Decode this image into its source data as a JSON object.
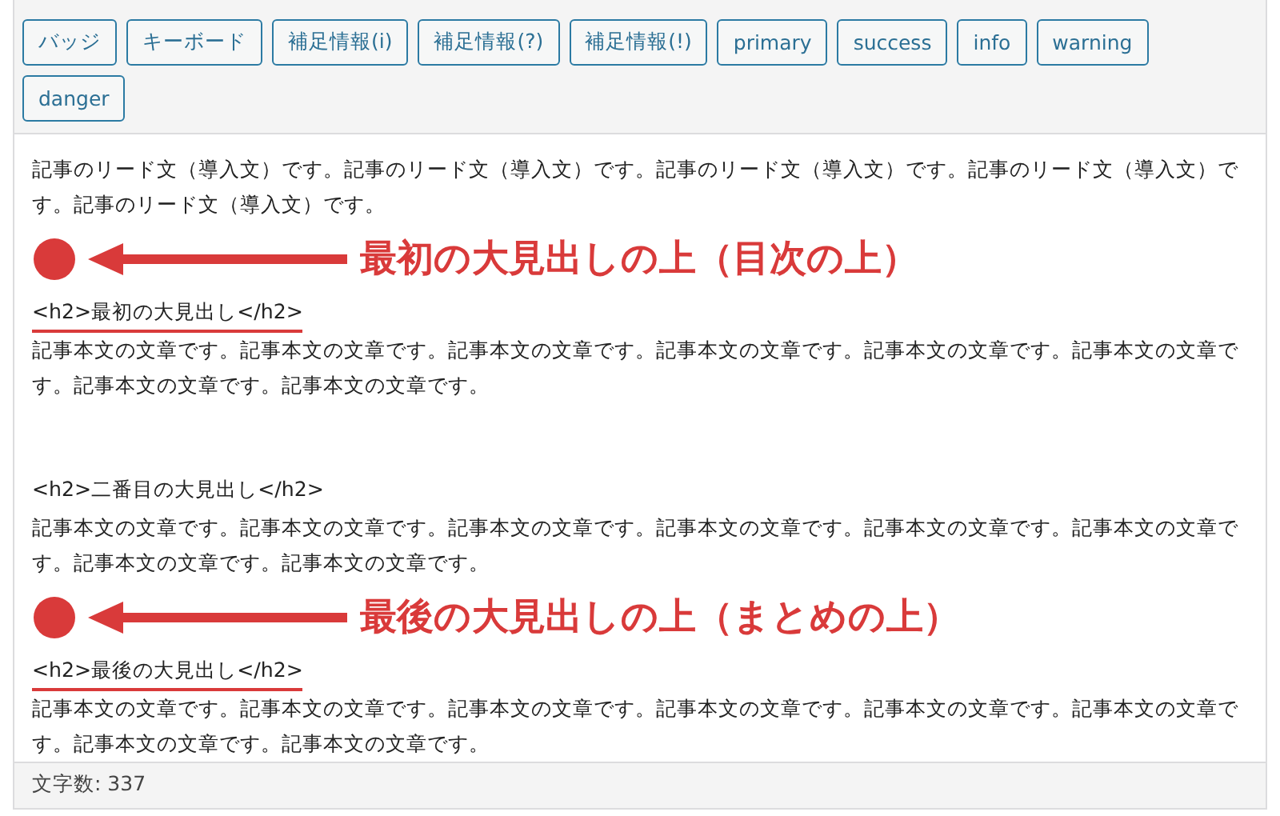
{
  "toolbar": {
    "buttons": [
      "バッジ",
      "キーボード",
      "補足情報(i)",
      "補足情報(?)",
      "補足情報(!)",
      "primary",
      "success",
      "info",
      "warning",
      "danger"
    ]
  },
  "content": [
    {
      "kind": "paragraph",
      "text": "記事のリード文（導入文）です。記事のリード文（導入文）です。記事のリード文（導入文）です。記事のリード文（導入文）です。記事のリード文（導入文）です。"
    },
    {
      "kind": "annotation",
      "text": "最初の大見出しの上（目次の上）"
    },
    {
      "kind": "heading",
      "text": "<h2>最初の大見出し</h2>",
      "marked": true
    },
    {
      "kind": "paragraph",
      "text": "記事本文の文章です。記事本文の文章です。記事本文の文章です。記事本文の文章です。記事本文の文章です。記事本文の文章です。記事本文の文章です。記事本文の文章です。"
    },
    {
      "kind": "heading",
      "text": "<h2>二番目の大見出し</h2>",
      "marked": false
    },
    {
      "kind": "paragraph",
      "text": "記事本文の文章です。記事本文の文章です。記事本文の文章です。記事本文の文章です。記事本文の文章です。記事本文の文章です。記事本文の文章です。記事本文の文章です。"
    },
    {
      "kind": "annotation",
      "text": "最後の大見出しの上（まとめの上）"
    },
    {
      "kind": "heading",
      "text": "<h2>最後の大見出し</h2>",
      "marked": true
    },
    {
      "kind": "paragraph",
      "text": "記事本文の文章です。記事本文の文章です。記事本文の文章です。記事本文の文章です。記事本文の文章です。記事本文の文章です。記事本文の文章です。記事本文の文章です。"
    }
  ],
  "status_bar": {
    "word_count": "文字数: 337"
  }
}
